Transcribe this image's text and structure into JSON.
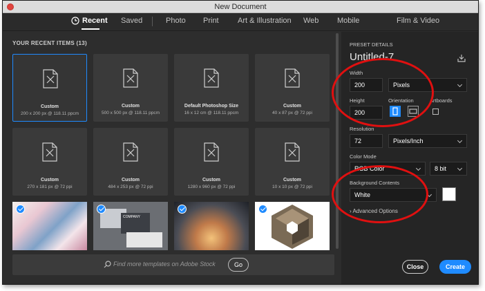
{
  "window": {
    "title": "New Document"
  },
  "tabs": [
    "Recent",
    "Saved",
    "Photo",
    "Print",
    "Art & Illustration",
    "Web",
    "Mobile",
    "Film & Video"
  ],
  "recent": {
    "heading": "YOUR RECENT ITEMS",
    "count": "(13)",
    "presets": [
      {
        "name": "Custom",
        "meta": "200 x 200 px @ 118.11 ppcm"
      },
      {
        "name": "Custom",
        "meta": "500 x 500 px @ 118.11 ppcm"
      },
      {
        "name": "Default Photoshop Size",
        "meta": "16 x 12 cm @ 118.11 ppcm"
      },
      {
        "name": "Custom",
        "meta": "40 x 87 px @ 72 ppi"
      },
      {
        "name": "Custom",
        "meta": "270 x 181 px @ 72 ppi"
      },
      {
        "name": "Custom",
        "meta": "484 x 253 px @ 72 ppi"
      },
      {
        "name": "Custom",
        "meta": "1280 x 960 px @ 72 ppi"
      },
      {
        "name": "Custom",
        "meta": "10 x 10 px @ 72 ppi"
      }
    ],
    "thumb_labels": [
      "COMPANY"
    ]
  },
  "stock": {
    "placeholder": "Find more templates on Adobe Stock",
    "go_label": "Go"
  },
  "preset_details": {
    "heading": "PRESET DETAILS",
    "name": "Untitled-7",
    "width_label": "Width",
    "width_value": "200",
    "width_unit": "Pixels",
    "height_label": "Height",
    "height_value": "200",
    "orientation_label": "Orientation",
    "artboards_label": "Artboards",
    "resolution_label": "Resolution",
    "resolution_value": "72",
    "resolution_unit": "Pixels/Inch",
    "color_mode_label": "Color Mode",
    "color_mode_value": "RGB Color",
    "bit_depth": "8 bit",
    "background_label": "Background Contents",
    "background_value": "White",
    "advanced_label": "Advanced Options"
  },
  "buttons": {
    "close": "Close",
    "create": "Create"
  },
  "colors": {
    "accent": "#1f8bff",
    "annotation": "#e01010",
    "panel": "#2d2d2d"
  }
}
